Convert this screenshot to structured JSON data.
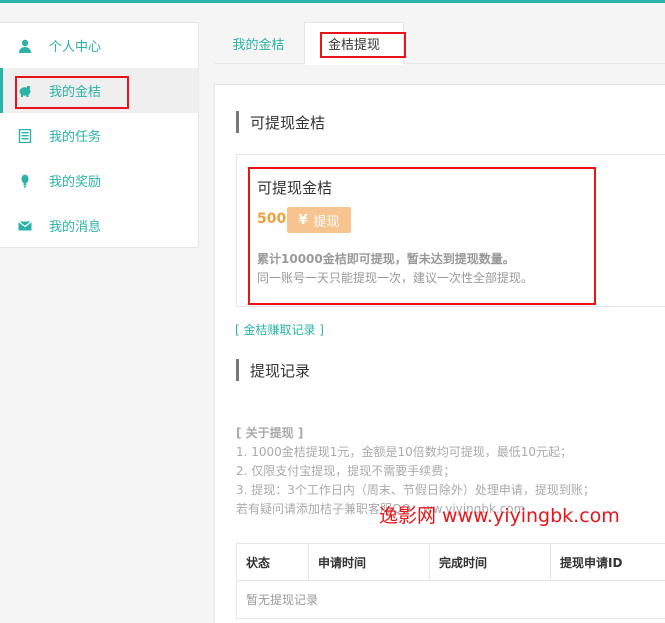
{
  "sidebar": {
    "items": [
      {
        "label": "个人中心",
        "icon": "user-icon"
      },
      {
        "label": "我的金桔",
        "icon": "piggy-bank-icon",
        "active": true
      },
      {
        "label": "我的任务",
        "icon": "list-icon"
      },
      {
        "label": "我的奖励",
        "icon": "bulb-icon"
      },
      {
        "label": "我的消息",
        "icon": "mail-icon"
      }
    ]
  },
  "tabs": [
    {
      "label": "我的金桔"
    },
    {
      "label": "金桔提现",
      "active": true
    }
  ],
  "withdrawable": {
    "section_title": "可提现金桔",
    "box_title": "可提现金桔",
    "amount": "500",
    "button_label": "提现",
    "button_symbol": "¥",
    "note_bold": "累计10000金桔即可提现，暂未达到提现数量。",
    "note": "同一账号一天只能提现一次，建议一次性全部提现。"
  },
  "earn_link": "[ 金桔赚取记录 ]",
  "records": {
    "section_title": "提现记录",
    "columns": [
      "状态",
      "申请时间",
      "完成时间",
      "提现申请ID"
    ],
    "empty_text": "暂无提现记录"
  },
  "about": {
    "head": "[ 关于提现 ]",
    "lines": [
      "1. 1000金桔提现1元，金额是10倍数均可提现，最低10元起；",
      "2. 仅限支付宝提现，提现不需要手续费；",
      "3. 提现：3个工作日内（周末、节假日除外）处理申请，提现到账；",
      "若有疑问请添加桔子兼职客服QQ：ww.yiyingbk.com"
    ]
  },
  "watermark": "逸影网 www.yiyingbk.com",
  "colors": {
    "accent": "#2ab3a6",
    "amount": "#f0a040",
    "button": "#f7c48f",
    "highlight": "#e8141a"
  }
}
